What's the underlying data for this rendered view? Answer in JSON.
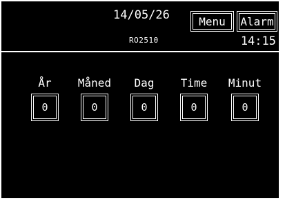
{
  "header": {
    "date": "14/05/26",
    "code": "RO2510",
    "menu_label": "Menu",
    "alarm_label": "Alarm",
    "time": "14:15"
  },
  "fields": [
    {
      "label": "År",
      "value": "0"
    },
    {
      "label": "Måned",
      "value": "0"
    },
    {
      "label": "Dag",
      "value": "0"
    },
    {
      "label": "Time",
      "value": "0"
    },
    {
      "label": "Minut",
      "value": "0"
    }
  ],
  "colors": {
    "background": "#000000",
    "foreground": "#ffffff"
  }
}
